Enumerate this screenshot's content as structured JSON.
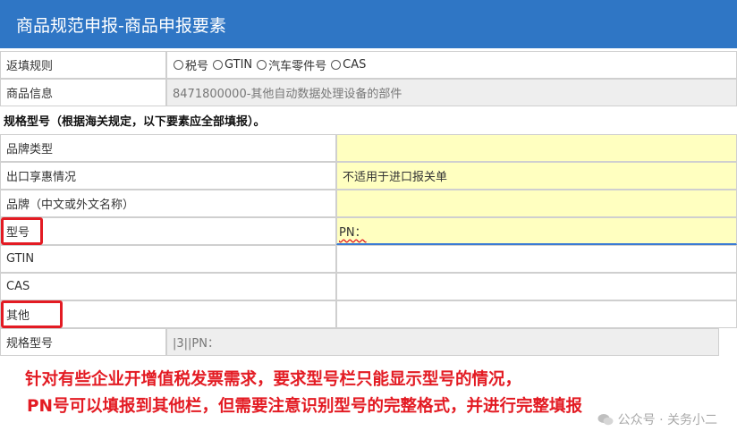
{
  "window": {
    "title": "商品规范申报-商品申报要素"
  },
  "form": {
    "return_rule": {
      "label": "返填规则",
      "options": [
        {
          "label": "税号"
        },
        {
          "label": "GTIN"
        },
        {
          "label": "汽车零件号"
        },
        {
          "label": "CAS"
        }
      ]
    },
    "product_info": {
      "label": "商品信息",
      "value": "8471800000-其他自动数据处理设备的部件"
    },
    "spec_section_title": "规格型号（根据海关规定，以下要素应全部填报）。",
    "fields": {
      "brand_type": {
        "label": "品牌类型",
        "value": ""
      },
      "export_benefit": {
        "label": "出口享惠情况",
        "value": "不适用于进口报关单"
      },
      "brand_name": {
        "label": "品牌（中文或外文名称）",
        "value": ""
      },
      "model": {
        "label": "型号",
        "value": "PN："
      },
      "gtin": {
        "label": "GTIN",
        "value": ""
      },
      "cas": {
        "label": "CAS",
        "value": ""
      },
      "other": {
        "label": "其他",
        "value": ""
      }
    },
    "spec_model": {
      "label": "规格型号",
      "value": "|3||PN："
    }
  },
  "annotation": {
    "line1": "针对有些企业开增值税发票需求，要求型号栏只能显示型号的情况，",
    "line2": "PN号可以填报到其他栏，但需要注意识别型号的完整格式，并进行完整填报"
  },
  "watermark": {
    "text": "公众号 · 关务小二"
  },
  "colors": {
    "title_bar": "#2f76c5",
    "required_field_bg": "#ffffc0",
    "readonly_bg": "#eeeeee",
    "highlight": "#e31b23"
  }
}
